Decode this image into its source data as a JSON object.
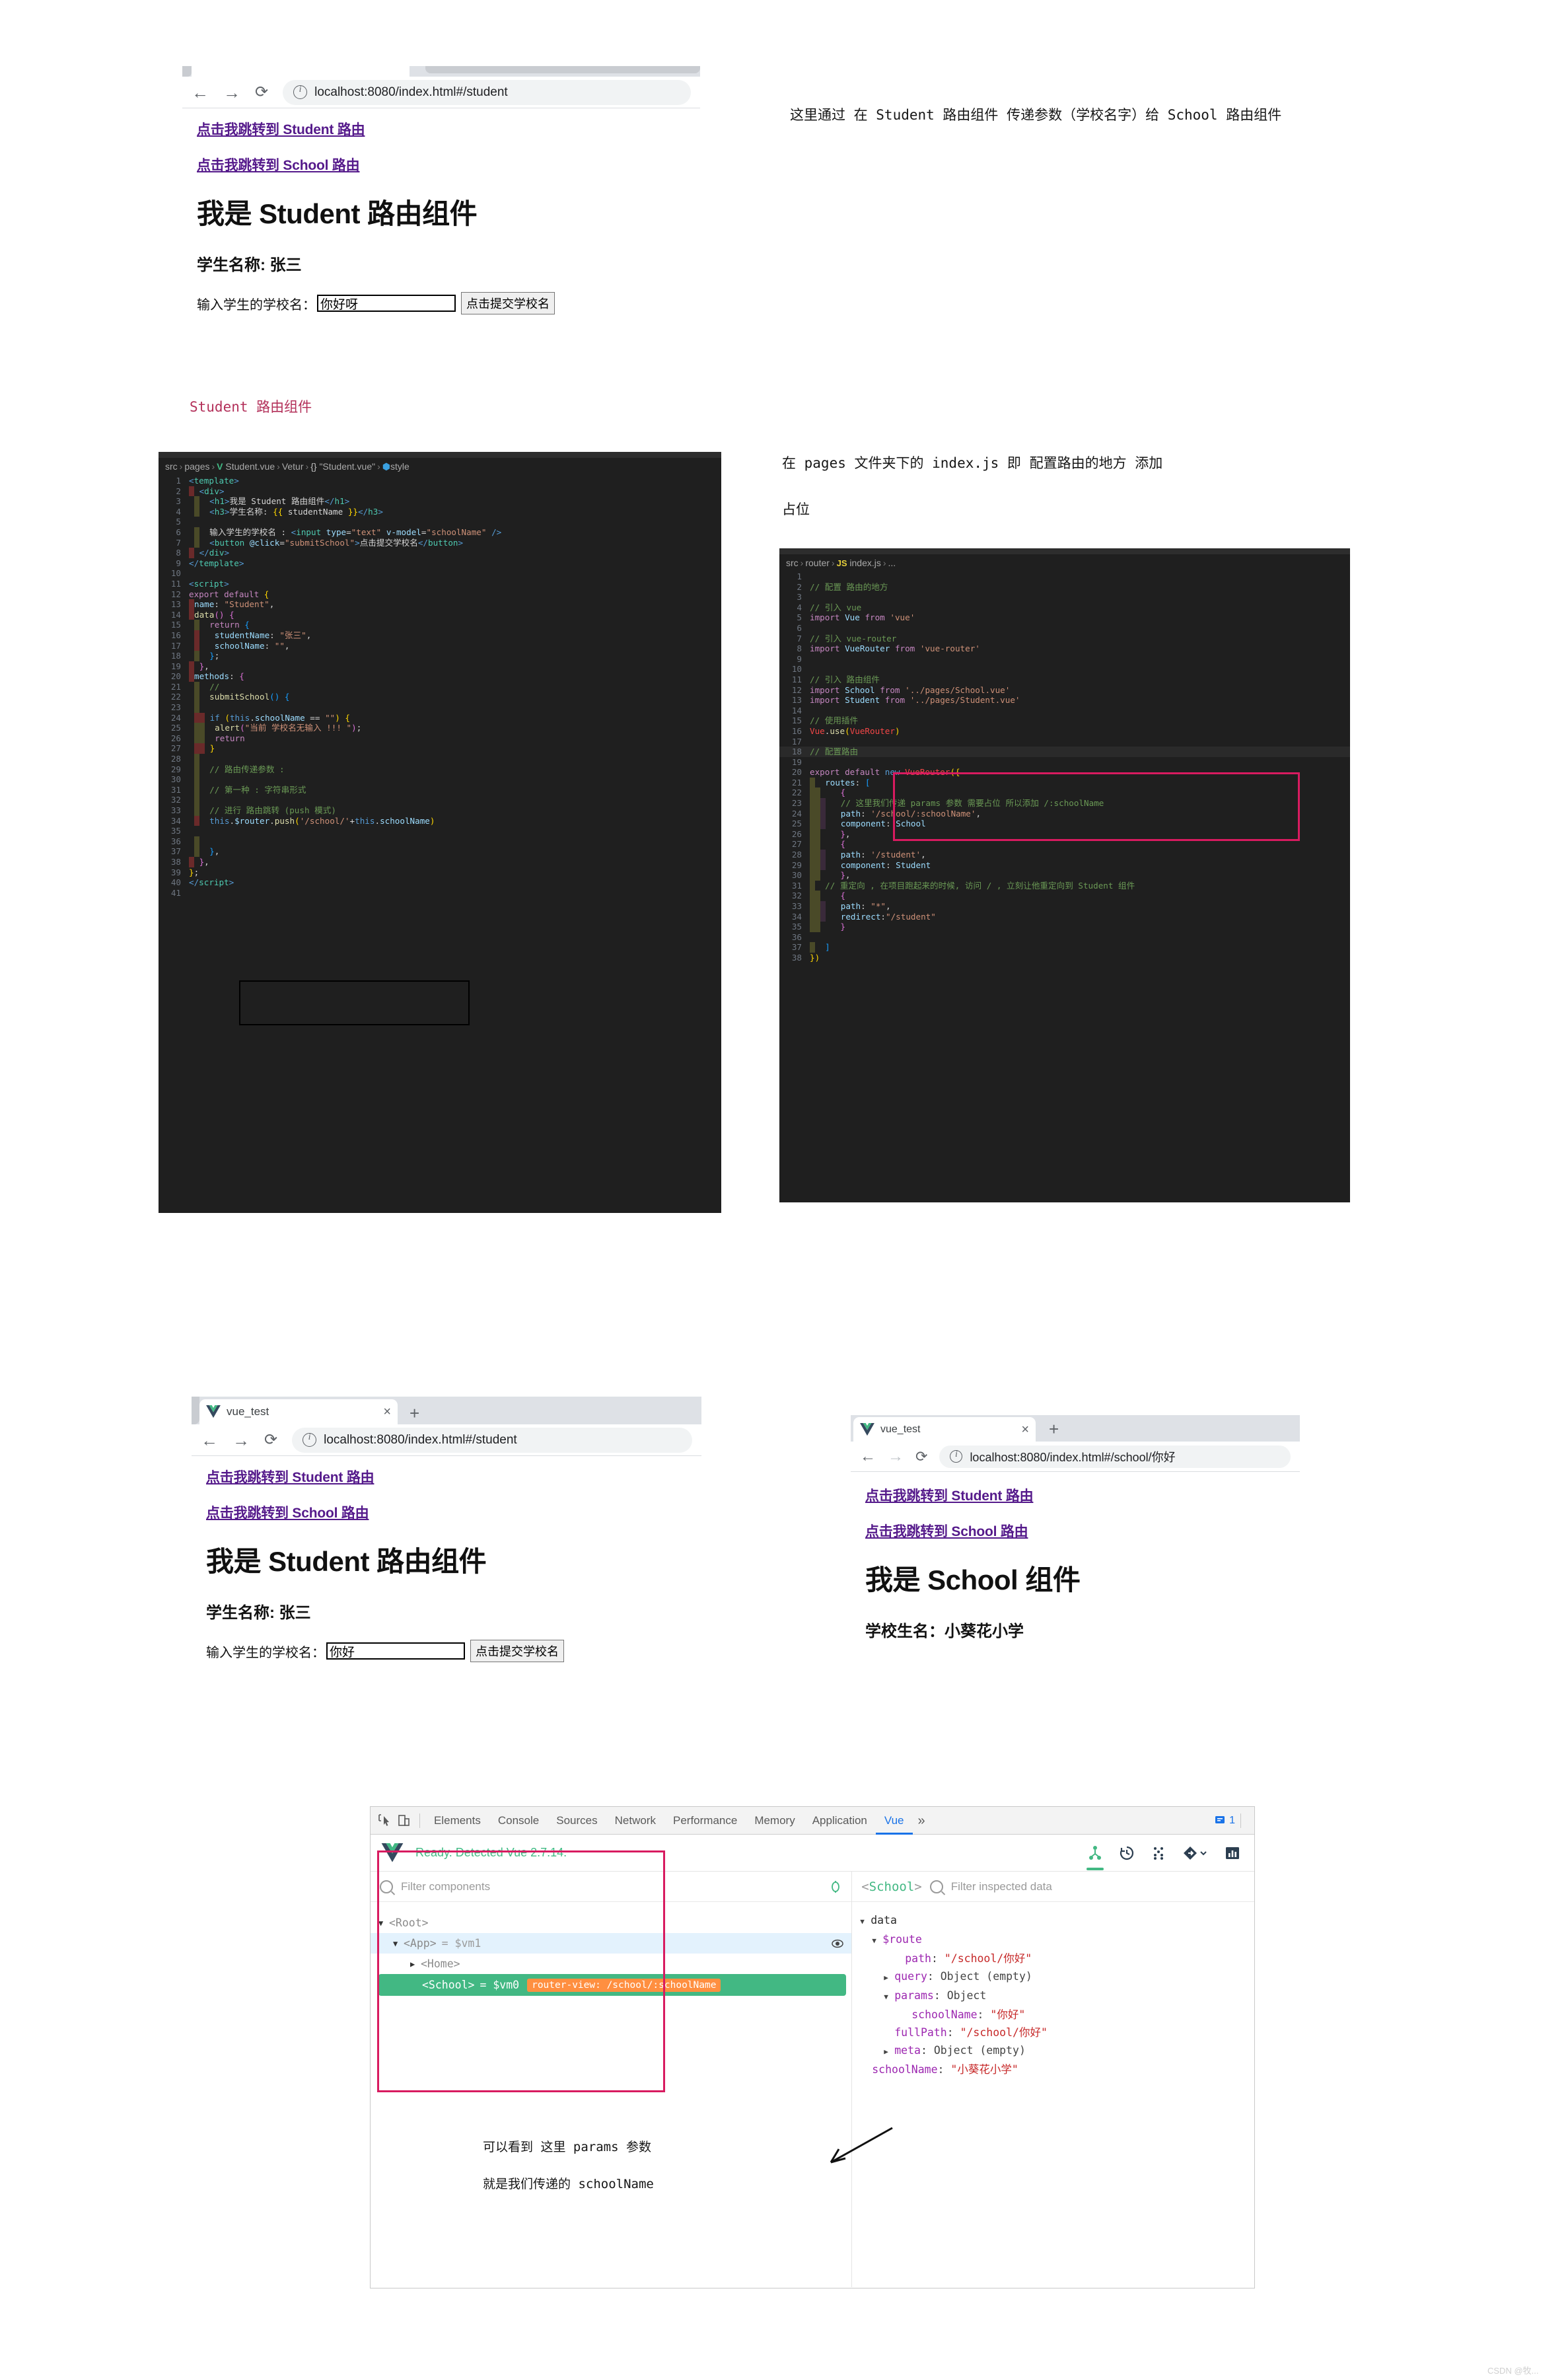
{
  "browser1": {
    "url": "localhost:8080/index.html#/student",
    "links": [
      "点击我跳转到 Student 路由",
      "点击我跳转到 School 路由"
    ],
    "h1": "我是 Student 路由组件",
    "h3": "学生名称: 张三",
    "form_label": "输入学生的学校名：",
    "input_value": "你好呀",
    "button": "点击提交学校名"
  },
  "browser2": {
    "tab_title": "vue_test",
    "tab_close": "×",
    "new_tab": "+",
    "url": "localhost:8080/index.html#/student",
    "links": [
      "点击我跳转到 Student 路由",
      "点击我跳转到 School 路由"
    ],
    "h1": "我是 Student 路由组件",
    "h3": "学生名称: 张三",
    "form_label": "输入学生的学校名：",
    "input_value": "你好",
    "button": "点击提交学校名"
  },
  "browser3": {
    "tab_title": "vue_test",
    "tab_close": "×",
    "new_tab": "+",
    "url": "localhost:8080/index.html#/school/你好",
    "links": [
      "点击我跳转到 Student 路由",
      "点击我跳转到 School 路由"
    ],
    "h1": "我是 School 组件",
    "h3": "学校生名：小葵花小学"
  },
  "annotations": {
    "top_right": "这里通过 在 Student 路由组件 传递参数（学校名字）给 School 路由组件",
    "student_label": "Student 路由组件",
    "router_note_line1": "在 pages 文件夹下的 index.js 即 配置路由的地方 添加",
    "router_note_line2": "占位",
    "params_note_line1": "可以看到 这里 params 参数",
    "params_note_line2": "就是我们传递的 schoolName"
  },
  "watermark": "CSDN @牧...",
  "editor_student": {
    "breadcrumb": [
      "src",
      "pages",
      "Student.vue",
      "Vetur",
      "{}",
      "\"Student.vue\"",
      "style"
    ],
    "last_line_no": 41,
    "lines": [
      {
        "n": 1,
        "text": "<template>"
      },
      {
        "n": 2,
        "text": "  <div>"
      },
      {
        "n": 3,
        "text": "    <h1>我是 Student 路由组件</h1>"
      },
      {
        "n": 4,
        "text": "    <h3>学生名称: {{ studentName }}</h3>"
      },
      {
        "n": 5,
        "text": ""
      },
      {
        "n": 6,
        "text": "    输入学生的学校名 : <input type=\"text\" v-model=\"schoolName\" />"
      },
      {
        "n": 7,
        "text": "    <button @click=\"submitSchool\">点击提交学校名</button>"
      },
      {
        "n": 8,
        "text": "  </div>"
      },
      {
        "n": 9,
        "text": "</template>"
      },
      {
        "n": 10,
        "text": ""
      },
      {
        "n": 11,
        "text": "<script>"
      },
      {
        "n": 12,
        "text": "export default {"
      },
      {
        "n": 13,
        "text": "  name: \"Student\","
      },
      {
        "n": 14,
        "text": "  data() {"
      },
      {
        "n": 15,
        "text": "    return {"
      },
      {
        "n": 16,
        "text": "      studentName: \"张三\","
      },
      {
        "n": 17,
        "text": "      schoolName: \"\","
      },
      {
        "n": 18,
        "text": "    };"
      },
      {
        "n": 19,
        "text": "  },"
      },
      {
        "n": 20,
        "text": "  methods: {"
      },
      {
        "n": 21,
        "text": "    //"
      },
      {
        "n": 22,
        "text": "    submitSchool() {"
      },
      {
        "n": 23,
        "text": ""
      },
      {
        "n": 24,
        "text": "      if (this.schoolName == \"\") {"
      },
      {
        "n": 25,
        "text": "        alert(\"当前 学校名无输入 !!! \");"
      },
      {
        "n": 26,
        "text": "        return"
      },
      {
        "n": 27,
        "text": "      }"
      },
      {
        "n": 28,
        "text": ""
      },
      {
        "n": 29,
        "text": "      // 路由传递参数 :"
      },
      {
        "n": 30,
        "text": ""
      },
      {
        "n": 31,
        "text": "      // 第一种 : 字符串形式"
      },
      {
        "n": 32,
        "text": ""
      },
      {
        "n": 33,
        "text": "      // 进行 路由跳转 (push 模式)"
      },
      {
        "n": 34,
        "text": "      this.$router.push('/school/'+this.schoolName)"
      },
      {
        "n": 35,
        "text": ""
      },
      {
        "n": 36,
        "text": ""
      },
      {
        "n": 37,
        "text": "    },"
      },
      {
        "n": 38,
        "text": "  },"
      },
      {
        "n": 39,
        "text": "};"
      },
      {
        "n": 40,
        "text": "</script>"
      },
      {
        "n": 41,
        "text": ""
      }
    ]
  },
  "editor_router": {
    "breadcrumb": [
      "src",
      "router",
      "index.js",
      "..."
    ],
    "lines": [
      {
        "n": 1,
        "text": ""
      },
      {
        "n": 2,
        "text": "// 配置 路由的地方"
      },
      {
        "n": 3,
        "text": ""
      },
      {
        "n": 4,
        "text": "// 引入 vue"
      },
      {
        "n": 5,
        "text": "import Vue from 'vue'"
      },
      {
        "n": 6,
        "text": ""
      },
      {
        "n": 7,
        "text": "// 引入 vue-router"
      },
      {
        "n": 8,
        "text": "import VueRouter from 'vue-router'"
      },
      {
        "n": 9,
        "text": ""
      },
      {
        "n": 10,
        "text": ""
      },
      {
        "n": 11,
        "text": "// 引入 路由组件"
      },
      {
        "n": 12,
        "text": "import School from '../pages/School.vue'"
      },
      {
        "n": 13,
        "text": "import Student from '../pages/Student.vue'"
      },
      {
        "n": 14,
        "text": ""
      },
      {
        "n": 15,
        "text": "// 使用插件"
      },
      {
        "n": 16,
        "text": "Vue.use(VueRouter)"
      },
      {
        "n": 17,
        "text": ""
      },
      {
        "n": 18,
        "text": "// 配置路由"
      },
      {
        "n": 19,
        "text": ""
      },
      {
        "n": 20,
        "text": "export default new VueRouter({"
      },
      {
        "n": 21,
        "text": "    routes: ["
      },
      {
        "n": 22,
        "text": "        {"
      },
      {
        "n": 23,
        "text": "            // 这里我们传递 params 参数 需要占位 所以添加 /:schoolName"
      },
      {
        "n": 24,
        "text": "            path: '/school/:schoolName',"
      },
      {
        "n": 25,
        "text": "            component: School"
      },
      {
        "n": 26,
        "text": "        },"
      },
      {
        "n": 27,
        "text": "        {"
      },
      {
        "n": 28,
        "text": "            path: '/student',"
      },
      {
        "n": 29,
        "text": "            component: Student"
      },
      {
        "n": 30,
        "text": "        },"
      },
      {
        "n": 31,
        "text": "        // 重定向 , 在项目跑起来的时候, 访问 / , 立刻让他重定向到 Student 组件"
      },
      {
        "n": 32,
        "text": "        {"
      },
      {
        "n": 33,
        "text": "            path: \"*\","
      },
      {
        "n": 34,
        "text": "            redirect:\"/student\""
      },
      {
        "n": 35,
        "text": "        }"
      },
      {
        "n": 36,
        "text": ""
      },
      {
        "n": 37,
        "text": "    ]"
      },
      {
        "n": 38,
        "text": "})"
      }
    ]
  },
  "devtools": {
    "tabs": [
      "Elements",
      "Console",
      "Sources",
      "Network",
      "Performance",
      "Memory",
      "Application",
      "Vue"
    ],
    "active_tab": "Vue",
    "overflow": "»",
    "issue_count": "1",
    "vue_status": "Ready. Detected Vue 2.7.14.",
    "filter_components_placeholder": "Filter components",
    "filter_inspected_placeholder": "Filter inspected data",
    "inspected_component": "School",
    "tree": [
      {
        "label": "<Root>",
        "depth": 0,
        "arrow": "▼",
        "vm": "",
        "badge": "",
        "state": "none"
      },
      {
        "label": "<App>",
        "depth": 1,
        "arrow": "▼",
        "vm": "= $vm1",
        "badge": "",
        "state": "hover"
      },
      {
        "label": "<Home>",
        "depth": 2,
        "arrow": "▶",
        "vm": "",
        "badge": "",
        "state": "none"
      },
      {
        "label": "<School>",
        "depth": 2,
        "arrow": "",
        "vm": "= $vm0",
        "badge": "router-view: /school/:schoolName",
        "state": "selected"
      }
    ],
    "data_rows": [
      {
        "tri": "▼",
        "indent": 0,
        "key": "data",
        "key_style": "plain",
        "value": ""
      },
      {
        "tri": "▼",
        "indent": 1,
        "key": "$route",
        "key_style": "purple",
        "value": ""
      },
      {
        "tri": "",
        "indent": 2,
        "key": "path",
        "key_style": "purple",
        "value": "\"/school/你好\""
      },
      {
        "tri": "▶",
        "indent": 2,
        "key": "query",
        "key_style": "purple",
        "value": "Object (empty)"
      },
      {
        "tri": "▼",
        "indent": 2,
        "key": "params",
        "key_style": "purple",
        "value": "Object"
      },
      {
        "tri": "",
        "indent": 3,
        "key": "schoolName",
        "key_style": "purple",
        "value": "\"你好\""
      },
      {
        "tri": "",
        "indent": 2,
        "key": "fullPath",
        "key_style": "purple",
        "value": "\"/school/你好\""
      },
      {
        "tri": "▶",
        "indent": 2,
        "key": "meta",
        "key_style": "purple",
        "value": "Object (empty)"
      },
      {
        "tri": "",
        "indent": 1,
        "key": "schoolName",
        "key_style": "purple",
        "value": "\"小葵花小学\""
      }
    ]
  }
}
